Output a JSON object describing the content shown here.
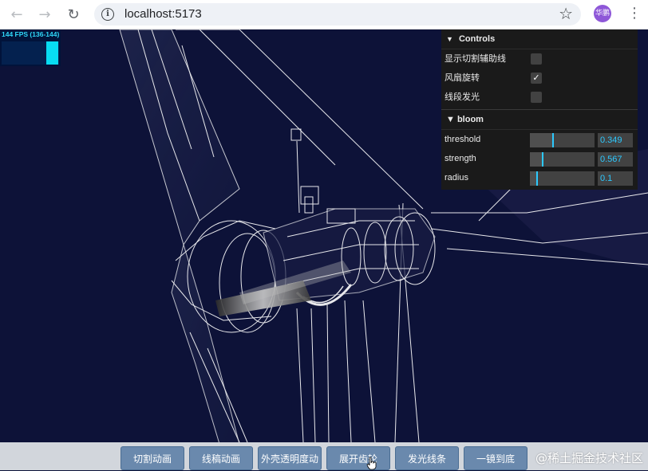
{
  "browser": {
    "back_icon": "arrow-left-icon",
    "forward_icon": "arrow-right-icon",
    "reload_icon": "reload-icon",
    "info_icon": "info-icon",
    "url": "localhost:5173",
    "bookmark_icon": "star-icon",
    "profile_label": "华鹏",
    "menu_icon": "kebab-menu-icon"
  },
  "stats": {
    "fps_label": "144 FPS (136-144)"
  },
  "controls": {
    "title": "Controls",
    "toggles": [
      {
        "label": "显示切割辅助线",
        "checked": false
      },
      {
        "label": "风扇旋转",
        "checked": true
      },
      {
        "label": "线段发光",
        "checked": false
      }
    ],
    "bloom": {
      "title": "bloom",
      "params": [
        {
          "label": "threshold",
          "value": "0.349",
          "fraction": 0.349
        },
        {
          "label": "strength",
          "value": "0.567",
          "fraction": 0.189
        },
        {
          "label": "radius",
          "value": "0.1",
          "fraction": 0.1
        }
      ]
    }
  },
  "actions": {
    "buttons": [
      "切割动画",
      "线稿动画",
      "外壳透明度动",
      "展开齿轮",
      "发光线条",
      "一镜到底"
    ]
  },
  "watermark": "@稀土掘金技术社区",
  "colors": {
    "background": "#0d1238",
    "wireframe": "#ffffff",
    "accent": "#2cc9ff",
    "button": "#6a89ad"
  }
}
